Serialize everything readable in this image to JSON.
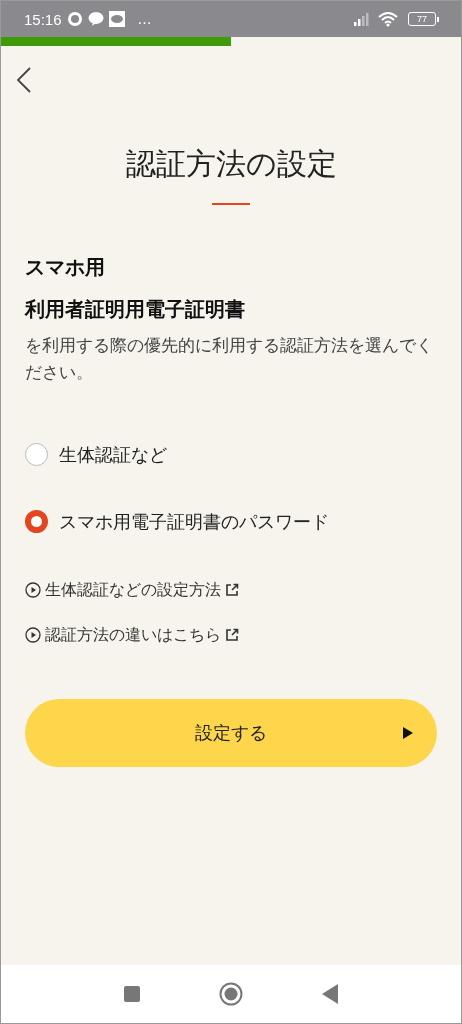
{
  "status_bar": {
    "time": "15:16",
    "more": "…",
    "battery": "77"
  },
  "progress": {
    "level": 0.5
  },
  "title": "認証方法の設定",
  "heading": [
    "スマホ用",
    "利用者証明用電子証明書"
  ],
  "description": "を利用する際の優先的に利用する認証方法を選んでください。",
  "options": [
    {
      "label": "生体認証など",
      "selected": false
    },
    {
      "label": "スマホ用電子証明書のパスワード",
      "selected": true
    }
  ],
  "links": [
    "生体認証などの設定方法",
    "認証方法の違いはこちら"
  ],
  "button": {
    "label": "設定する"
  }
}
